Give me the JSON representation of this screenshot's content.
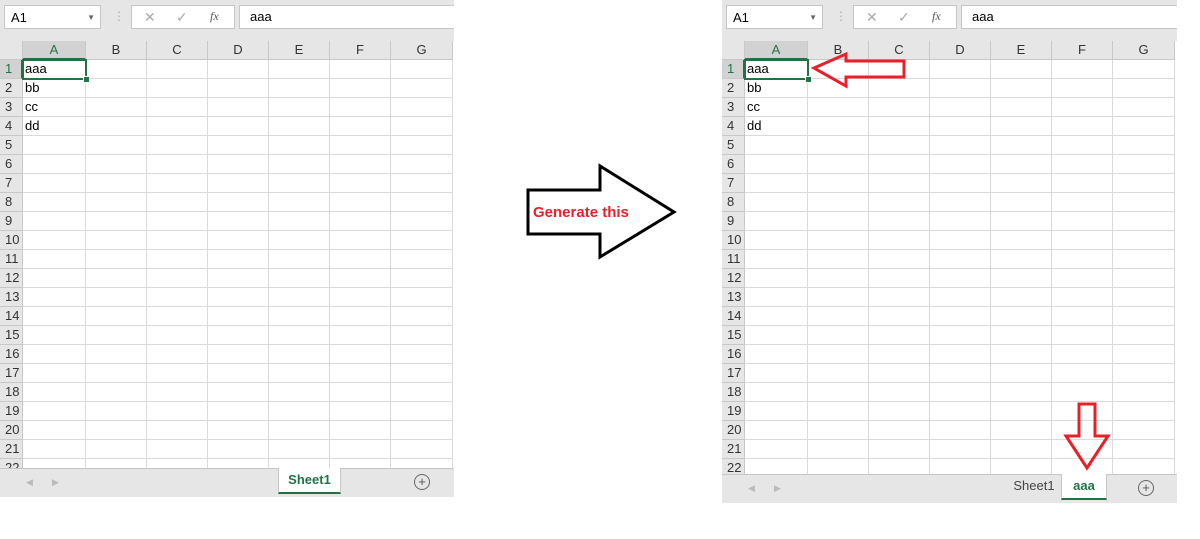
{
  "columns": [
    "A",
    "B",
    "C",
    "D",
    "E",
    "F",
    "G"
  ],
  "rows": [
    "1",
    "2",
    "3",
    "4",
    "5",
    "6",
    "7",
    "8",
    "9",
    "10",
    "11",
    "12",
    "13",
    "14",
    "15",
    "16",
    "17",
    "18",
    "19",
    "20",
    "21",
    "22"
  ],
  "cells_A": [
    "aaa",
    "bb",
    "cc",
    "dd"
  ],
  "left": {
    "name_box": "A1",
    "formula": "aaa",
    "fx": "fx",
    "tabs": [
      "Sheet1"
    ],
    "active_tab": 0
  },
  "right": {
    "name_box": "A1",
    "formula": "aaa",
    "fx": "fx",
    "tabs": [
      "Sheet1",
      "aaa"
    ],
    "active_tab": 1
  },
  "arrow_label": "Generate this",
  "colors": {
    "accent": "#217346",
    "annotation": "#e8202a"
  }
}
